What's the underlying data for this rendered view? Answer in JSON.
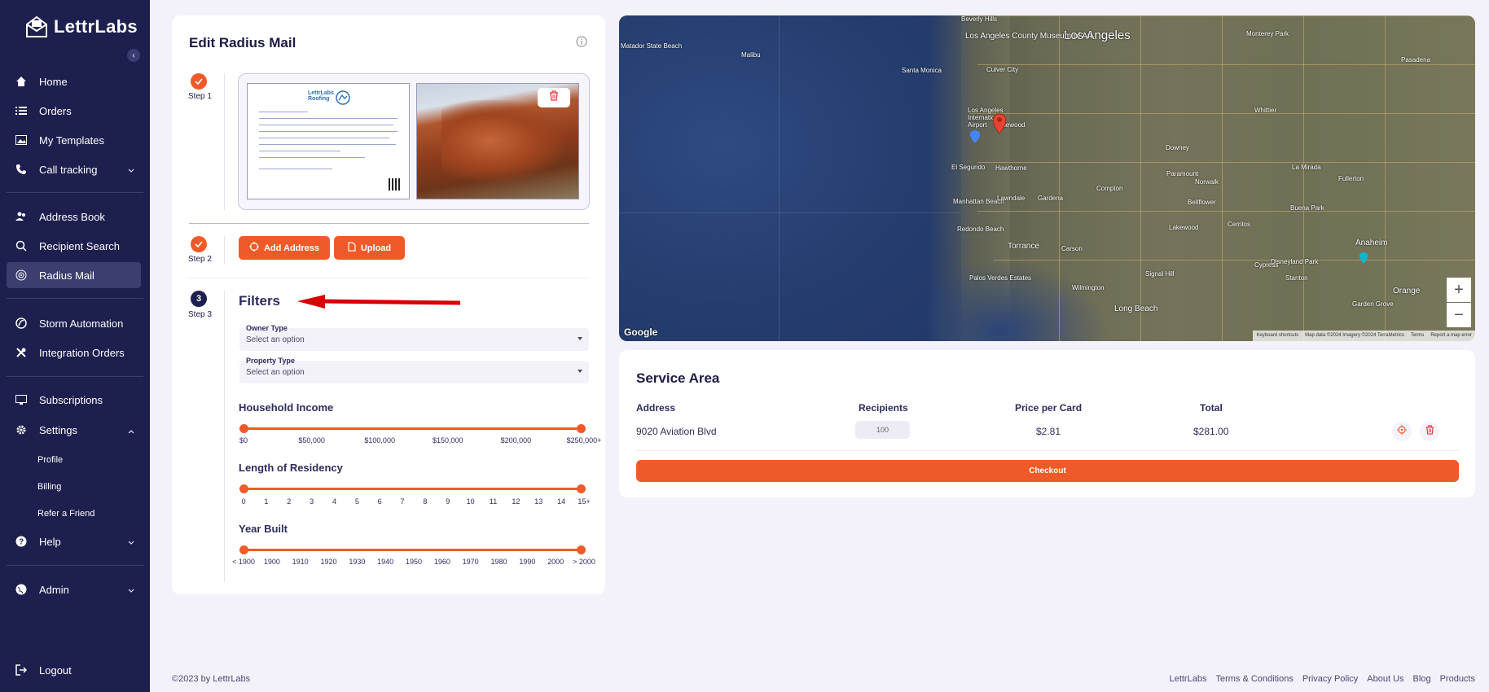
{
  "brand": {
    "name": "LettrLabs",
    "accent": "#f05a28",
    "sidebar_bg": "#1d1f4e"
  },
  "sidebar": {
    "items": [
      {
        "label": "Home",
        "icon": "home-icon"
      },
      {
        "label": "Orders",
        "icon": "list-icon"
      },
      {
        "label": "My Templates",
        "icon": "image-icon"
      },
      {
        "label": "Call tracking",
        "icon": "phone-icon"
      },
      {
        "label": "Address Book",
        "icon": "users-icon"
      },
      {
        "label": "Recipient Search",
        "icon": "search-user-icon"
      },
      {
        "label": "Radius Mail",
        "icon": "radius-icon",
        "active": true
      },
      {
        "label": "Storm Automation",
        "icon": "storm-icon"
      },
      {
        "label": "Integration Orders",
        "icon": "tools-icon"
      },
      {
        "label": "Subscriptions",
        "icon": "monitor-icon"
      },
      {
        "label": "Settings",
        "icon": "gear-icon"
      },
      {
        "label": "Help",
        "icon": "help-icon"
      },
      {
        "label": "Admin",
        "icon": "globe-icon"
      },
      {
        "label": "Logout",
        "icon": "logout-icon"
      }
    ],
    "settings_sub": [
      "Profile",
      "Billing",
      "Refer a Friend"
    ]
  },
  "edit": {
    "title": "Edit Radius Mail",
    "steps": [
      "Step 1",
      "Step 2",
      "Step 3"
    ],
    "step3_number": "3",
    "postcard_logo": "LettrLabs",
    "postcard_logo_sub": "Roofing",
    "add_address_label": "Add Address",
    "upload_label": "Upload",
    "filters_title": "Filters",
    "owner_type": {
      "label": "Owner Type",
      "value": "Select an option"
    },
    "property_type": {
      "label": "Property Type",
      "value": "Select an option"
    },
    "household_income": {
      "title": "Household Income",
      "ticks": [
        "$0",
        "$50,000",
        "$100,000",
        "$150,000",
        "$200,000",
        "$250,000+"
      ],
      "range": [
        0,
        1
      ]
    },
    "length_residency": {
      "title": "Length of Residency",
      "ticks": [
        "0",
        "1",
        "2",
        "3",
        "4",
        "5",
        "6",
        "7",
        "8",
        "9",
        "10",
        "11",
        "12",
        "13",
        "14",
        "15+"
      ],
      "range": [
        0,
        1
      ]
    },
    "year_built": {
      "title": "Year Built",
      "ticks": [
        "< 1900",
        "1900",
        "1910",
        "1920",
        "1930",
        "1940",
        "1950",
        "1960",
        "1970",
        "1980",
        "1990",
        "2000",
        "> 2000"
      ],
      "range": [
        0,
        1
      ]
    }
  },
  "map": {
    "labels": [
      "Los Angeles",
      "Beverly Hills",
      "Los Angeles County Museum of Art",
      "Matador State Beach",
      "Santa Monica",
      "Culver City",
      "Malibu",
      "Inglewood",
      "Los Angeles International Airport",
      "El Segundo",
      "Hawthorne",
      "Manhattan Beach",
      "Redondo Beach",
      "Torrance",
      "Palos Verdes Estates",
      "Long Beach",
      "Compton",
      "Downey",
      "Norwalk",
      "Anaheim",
      "Orange",
      "Disneyland Park",
      "Carson",
      "Lakewood",
      "Cerritos",
      "Whittier",
      "La Mirada",
      "Fullerton",
      "Buena Park",
      "Gardena",
      "Lawndale",
      "Wilmington",
      "Signal Hill",
      "Paramount",
      "Bellflower",
      "Cypress",
      "Stanton",
      "Garden Grove",
      "Monterey Park",
      "Pasadena"
    ],
    "google": "Google",
    "zoom_in": "+",
    "zoom_out": "−",
    "attribution": [
      "Keyboard shortcuts",
      "Map data ©2024 Imagery ©2024 TerraMetrics",
      "Terms",
      "Report a map error"
    ]
  },
  "service_area": {
    "title": "Service Area",
    "headers": [
      "Address",
      "Recipients",
      "Price per Card",
      "Total"
    ],
    "row": {
      "address": "9020 Aviation Blvd",
      "recipients": "100",
      "price": "$2.81",
      "total": "$281.00"
    },
    "checkout_label": "Checkout"
  },
  "footer": {
    "copyright": "©2023 by LettrLabs",
    "links": [
      "LettrLabs",
      "Terms & Conditions",
      "Privacy Policy",
      "About Us",
      "Blog",
      "Products"
    ]
  }
}
